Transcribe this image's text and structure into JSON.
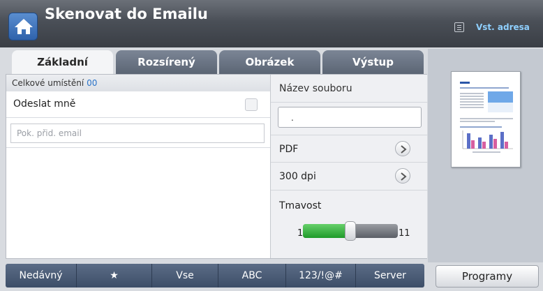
{
  "header": {
    "title": "Skenovat do Emailu",
    "address_label": "Vst. adresa",
    "home_icon": "home-icon",
    "address_icon": "address-book-icon"
  },
  "tabs": [
    {
      "label": "Základní",
      "active": true
    },
    {
      "label": "Rozsírený",
      "active": false
    },
    {
      "label": "Obrázek",
      "active": false
    },
    {
      "label": "Výstup",
      "active": false
    }
  ],
  "destinations": {
    "label": "Celkové umístění",
    "count": "00"
  },
  "send_to_me": {
    "label": "Odeslat mně",
    "checked": false
  },
  "email": {
    "placeholder": "Pok. přid. email"
  },
  "file": {
    "label": "Název souboru",
    "value": "."
  },
  "format": {
    "value": "PDF"
  },
  "resolution": {
    "value": "300 dpi"
  },
  "darkness": {
    "label": "Tmavost",
    "min": "1",
    "max": "11",
    "level": 6
  },
  "bottom_bar": [
    {
      "label": "Nedávný"
    },
    {
      "label": "★"
    },
    {
      "label": "Vse"
    },
    {
      "label": "ABC"
    },
    {
      "label": "123/!@#"
    },
    {
      "label": "Server"
    }
  ],
  "programs": {
    "label": "Programy"
  },
  "colors": {
    "header": "#4a4f57",
    "accent_link": "#8fd0ff",
    "slider_fill": "#1f9a2a",
    "tab_inactive": "#6a7483"
  }
}
